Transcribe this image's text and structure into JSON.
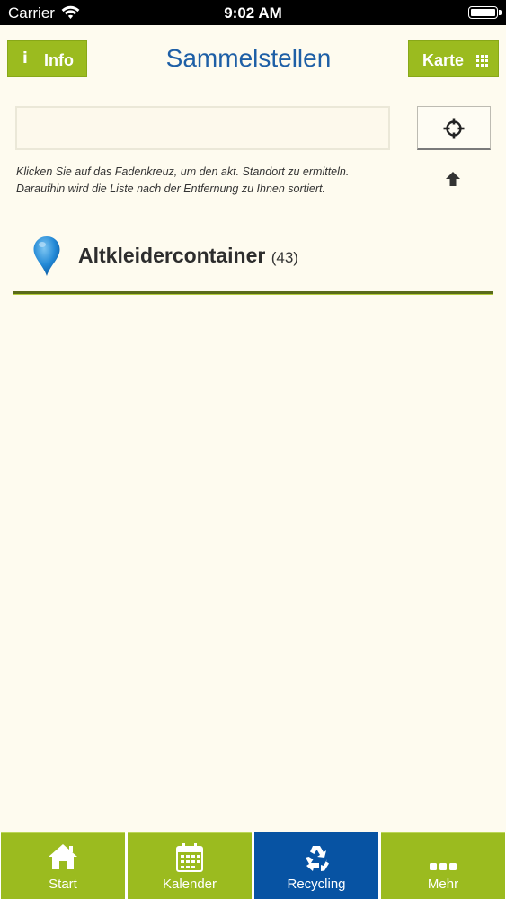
{
  "status_bar": {
    "carrier": "Carrier",
    "time": "9:02 AM"
  },
  "header": {
    "info_label": "Info",
    "title": "Sammelstellen",
    "map_label": "Karte"
  },
  "search": {
    "value": "",
    "placeholder": ""
  },
  "hint": {
    "line1": "Klicken Sie auf das Fadenkreuz, um den akt. Standort zu ermitteln.",
    "line2": "Daraufhin wird die Liste nach der Entfernung zu Ihnen sortiert."
  },
  "list": {
    "items": [
      {
        "name": "Altkleidercontainer",
        "count": "(43)",
        "icon": "map-pin-icon"
      }
    ]
  },
  "tabs": [
    {
      "label": "Start",
      "icon": "home-icon"
    },
    {
      "label": "Kalender",
      "icon": "calendar-icon"
    },
    {
      "label": "Recycling",
      "icon": "recycling-icon",
      "active": true
    },
    {
      "label": "Mehr",
      "icon": "more-icon"
    }
  ],
  "colors": {
    "background": "#fefbef",
    "accent_green": "#9bbb1f",
    "active_blue": "#0753a3",
    "title_blue": "#1e5fa6"
  }
}
